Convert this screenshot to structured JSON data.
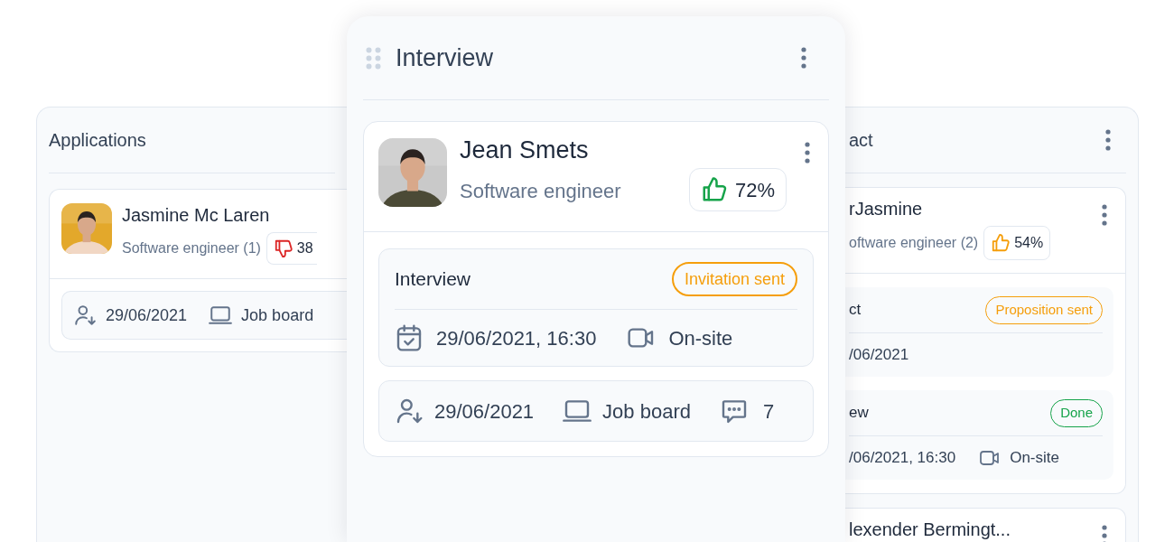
{
  "columns": [
    {
      "kind": "left",
      "title": "Applications",
      "cards": [
        {
          "name": "Jasmine Mc Laren",
          "role": "Software engineer (1)",
          "avatar": {
            "kind": "picture"
          },
          "score": {
            "value": "38",
            "kind": "down",
            "color": "#dc2626"
          },
          "footer": {
            "date": "29/06/2021",
            "source": "Job board"
          }
        }
      ]
    },
    {
      "kind": "front",
      "title": "Interview",
      "cards": [
        {
          "name": "Jean Smets",
          "role": "Software engineer",
          "avatar": {
            "kind": "picture"
          },
          "score": {
            "value": "72%",
            "kind": "up",
            "color": "#16a34a"
          },
          "steps": [
            {
              "title": "Interview",
              "status": {
                "label": "Invitation sent",
                "color": "#f59e0b"
              },
              "date": "29/06/2021, 16:30",
              "mode": "On-site"
            }
          ],
          "footer": {
            "date": "29/06/2021",
            "source": "Job board",
            "comments": "7"
          }
        }
      ]
    },
    {
      "kind": "right",
      "title": "act",
      "cards": [
        {
          "name": "rJasmine",
          "role": "oftware engineer (2)",
          "score": {
            "value": "54%",
            "kind": "up",
            "color": "#f59e0b"
          },
          "steps": [
            {
              "title": "ct",
              "status": {
                "label": "Proposition sent",
                "color": "#f59e0b"
              },
              "date": "/06/2021"
            },
            {
              "title": "ew",
              "status": {
                "label": "Done",
                "color": "#16a34a"
              },
              "date": "/06/2021, 16:30",
              "mode": "On-site"
            }
          ]
        },
        {
          "name": "lexender Bermingt..."
        }
      ]
    }
  ]
}
